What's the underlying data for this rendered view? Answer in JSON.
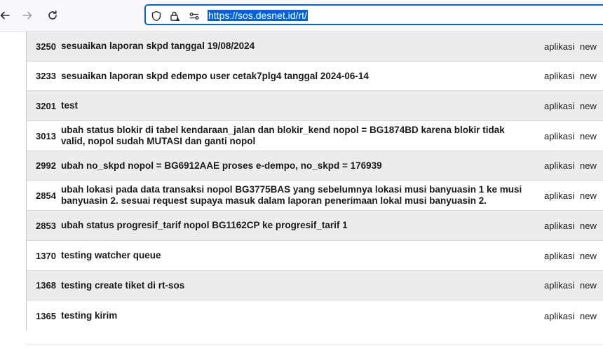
{
  "browser": {
    "url": "https://sos.desnet.id/rt/",
    "back_icon": "arrow-left-icon",
    "forward_icon": "arrow-right-icon",
    "reload_icon": "reload-icon",
    "shield_icon": "shield-icon",
    "lock_icon": "lock-warning-icon",
    "permissions_icon": "permissions-icon"
  },
  "tickets": [
    {
      "id": "3250",
      "subject": "sesuaikan laporan skpd tanggal 19/08/2024",
      "queue": "aplikasi",
      "status": "new"
    },
    {
      "id": "3233",
      "subject": "sesuaikan laporan skpd edempo user cetak7plg4 tanggal 2024-06-14",
      "queue": "aplikasi",
      "status": "new"
    },
    {
      "id": "3201",
      "subject": "test",
      "queue": "aplikasi",
      "status": "new"
    },
    {
      "id": "3013",
      "subject": "ubah status blokir di tabel kendaraan_jalan dan blokir_kend nopol = BG1874BD karena blokir tidak valid, nopol sudah MUTASI dan ganti nopol",
      "queue": "aplikasi",
      "status": "new"
    },
    {
      "id": "2992",
      "subject": "ubah no_skpd nopol = BG6912AAE proses e-dempo, no_skpd = 176939",
      "queue": "aplikasi",
      "status": "new"
    },
    {
      "id": "2854",
      "subject": "ubah lokasi pada data transaksi nopol BG3775BAS yang sebelumnya lokasi musi banyuasin 1 ke musi banyuasin 2. sesuai request supaya masuk dalam laporan penerimaan lokal musi banyuasin 2.",
      "queue": "aplikasi",
      "status": "new"
    },
    {
      "id": "2853",
      "subject": "ubah status progresif_tarif nopol BG1162CP ke progresif_tarif 1",
      "queue": "aplikasi",
      "status": "new"
    },
    {
      "id": "1370",
      "subject": "testing watcher queue",
      "queue": "aplikasi",
      "status": "new"
    },
    {
      "id": "1368",
      "subject": "testing create tiket di rt-sos",
      "queue": "aplikasi",
      "status": "new"
    },
    {
      "id": "1365",
      "subject": "testing kirim",
      "queue": "aplikasi",
      "status": "new"
    }
  ],
  "colors": {
    "row_shaded": "#ececec",
    "row_plain": "#ffffff",
    "url_highlight": "#0061e0"
  }
}
